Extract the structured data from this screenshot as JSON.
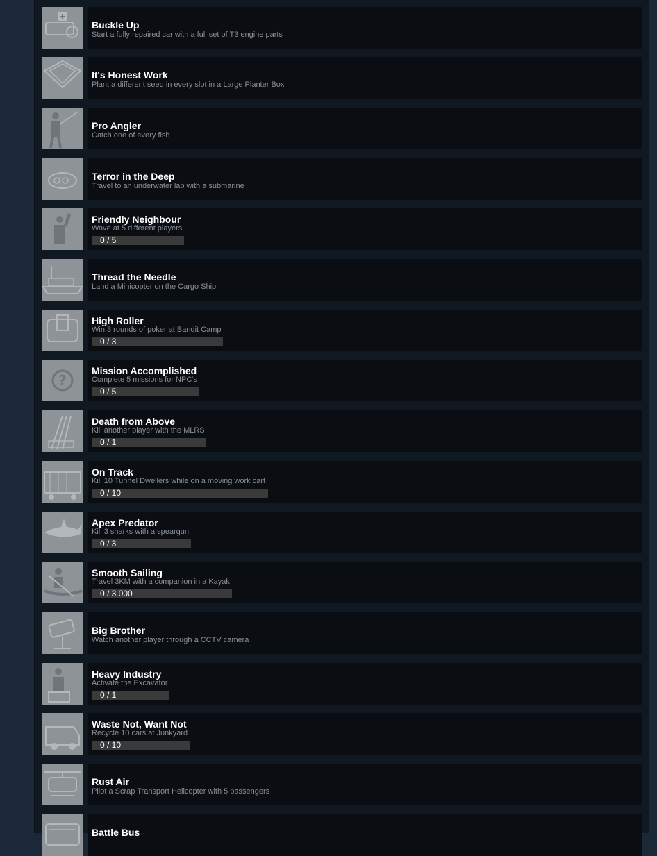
{
  "achievements": [
    {
      "title": "Buckle Up",
      "description": "Start a fully repaired car with a full set of T3 engine parts",
      "icon": "car-engine-icon"
    },
    {
      "title": "It's Honest Work",
      "description": "Plant a different seed in every slot in a Large Planter Box",
      "icon": "planter-box-icon"
    },
    {
      "title": "Pro Angler",
      "description": "Catch one of every fish",
      "icon": "fisherman-icon"
    },
    {
      "title": "Terror in the Deep",
      "description": "Travel to an underwater lab with a submarine",
      "icon": "submarine-icon"
    },
    {
      "title": "Friendly Neighbour",
      "description": "Wave at 5 different players",
      "icon": "waving-player-icon",
      "progress": {
        "text": "0 / 5",
        "fraction": 0
      }
    },
    {
      "title": "Thread the Needle",
      "description": "Land a Minicopter on the Cargo Ship",
      "icon": "cargo-ship-icon"
    },
    {
      "title": "High Roller",
      "description": "Win 3 rounds of poker at Bandit Camp",
      "icon": "poker-table-icon",
      "progress": {
        "text": "0 / 3",
        "fraction": 0
      }
    },
    {
      "title": "Mission Accomplished",
      "description": "Complete 5 missions for NPC's",
      "icon": "question-mark-icon",
      "progress": {
        "text": "0 / 5",
        "fraction": 0
      }
    },
    {
      "title": "Death from Above",
      "description": "Kill another player with the MLRS",
      "icon": "mlrs-icon",
      "progress": {
        "text": "0 / 1",
        "fraction": 0
      }
    },
    {
      "title": "On Track",
      "description": "Kill 10 Tunnel Dwellers while on a moving work cart",
      "icon": "work-cart-icon",
      "progress": {
        "text": "0 / 10",
        "fraction": 0
      }
    },
    {
      "title": "Apex Predator",
      "description": "Kill 3 sharks with a speargun",
      "icon": "shark-icon",
      "progress": {
        "text": "0 / 3",
        "fraction": 0
      }
    },
    {
      "title": "Smooth Sailing",
      "description": "Travel 3KM with a companion in a Kayak",
      "icon": "kayak-icon",
      "progress": {
        "text": "0 / 3.000",
        "fraction": 0
      }
    },
    {
      "title": "Big Brother",
      "description": "Watch another player through a CCTV camera",
      "icon": "cctv-camera-icon"
    },
    {
      "title": "Heavy Industry",
      "description": "Activate the Excavator",
      "icon": "excavator-icon",
      "progress": {
        "text": "0 / 1",
        "fraction": 0
      }
    },
    {
      "title": "Waste Not, Want Not",
      "description": "Recycle 10 cars at Junkyard",
      "icon": "junk-car-icon",
      "progress": {
        "text": "0 / 10",
        "fraction": 0
      }
    },
    {
      "title": "Rust Air",
      "description": "Pilot a Scrap Transport Helicopter with 5 passengers",
      "icon": "helicopter-icon"
    },
    {
      "title": "Battle Bus",
      "description": "",
      "icon": "bus-icon"
    }
  ]
}
